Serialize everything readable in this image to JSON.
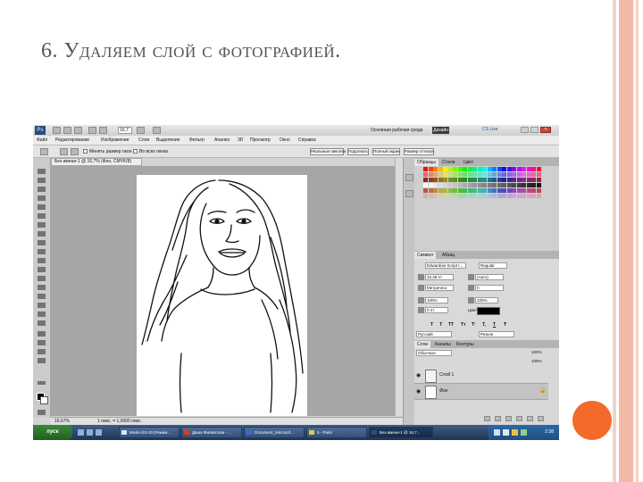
{
  "slide": {
    "title": "6. Удаляем слой с фотографией."
  },
  "app": {
    "logo": "Ps",
    "zoom": "16,7",
    "workspace": "Основная рабочая среда",
    "design_button": "Дизайн",
    "cs_live": "CS Live"
  },
  "menu": [
    "Файл",
    "Редактирование",
    "Изображение",
    "Слои",
    "Выделение",
    "Фильтр",
    "Анализ",
    "3D",
    "Просмотр",
    "Окно",
    "Справка"
  ],
  "options": {
    "resize_windows": "Менять размер окон",
    "all_windows": "Во всех окнах",
    "buttons": [
      "Реальные пиксели",
      "Подогнать",
      "Полный экран",
      "Размер оттиска"
    ]
  },
  "document": {
    "tab_title": "Без имени-1 @ 16,7% (Фон, CMYK/8)"
  },
  "status": {
    "zoom": "16,67%",
    "info": "1 пикс. = 1,0000 пикс."
  },
  "swatches_panel": {
    "tabs": [
      "Образцы",
      "Стили",
      "Цвет"
    ]
  },
  "character_panel": {
    "tabs": [
      "Символ",
      "Абзац"
    ],
    "font_family": "Edwardian Script I...",
    "font_style": "Regular",
    "font_size": "32,48 пт",
    "leading": "(Авто)",
    "kerning": "Метрическ",
    "tracking": "0",
    "vscale": "100%",
    "hscale": "100%",
    "baseline": "0 пт",
    "color_label": "Цвет:",
    "glyphs": [
      "T",
      "T",
      "TT",
      "Tт",
      "T¹",
      "T,",
      "T",
      "Ŧ"
    ],
    "language": "Русский",
    "antialias": "Резкое"
  },
  "layers_panel": {
    "tabs": [
      "Слои",
      "Каналы",
      "Контуры"
    ],
    "blend_mode": "Обычные",
    "opacity": "100%",
    "fill": "100%",
    "layers": [
      "Слой 1",
      "Фон"
    ]
  },
  "taskbar": {
    "start": "пуск",
    "tasks": [
      "Mosk-s10-10 [Режим...",
      "Даша Филиппова - ...",
      "Document_Microsof...",
      "5 - Paint",
      "Без имени-1 @ 16,7..."
    ],
    "clock": "2:38"
  },
  "colors": {
    "accent_orange": "#f46a2a",
    "deco_stripe": "#f2b9a6",
    "taskbar_blue": "#1d3455"
  }
}
